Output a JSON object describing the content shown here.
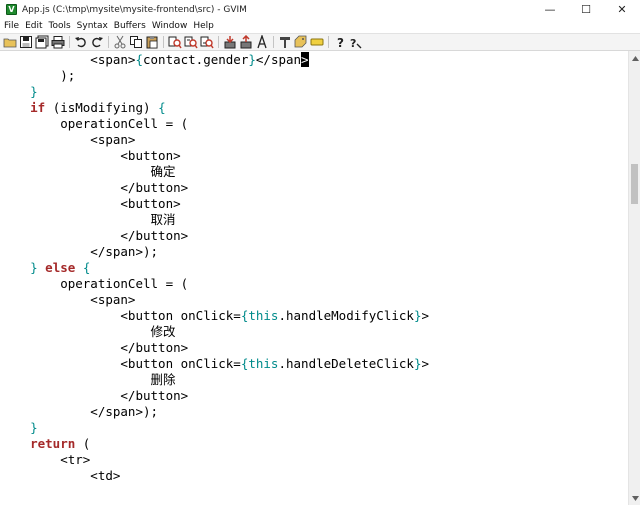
{
  "window": {
    "title": "App.js (C:\\tmp\\mysite\\mysite-frontend\\src) - GVIM",
    "app_icon_letter": "V",
    "controls": {
      "minimize": "—",
      "maximize": "☐",
      "close": "✕"
    }
  },
  "menu": [
    "File",
    "Edit",
    "Tools",
    "Syntax",
    "Buffers",
    "Window",
    "Help"
  ],
  "toolbar": [
    "open-icon",
    "save-icon",
    "save-all-icon",
    "print-icon",
    "sep",
    "undo-icon",
    "redo-icon",
    "sep",
    "cut-icon",
    "copy-icon",
    "paste-icon",
    "sep",
    "find-replace-icon",
    "find-next-icon",
    "find-prev-icon",
    "sep",
    "load-session-icon",
    "save-session-icon",
    "run-script-icon",
    "sep",
    "make-icon",
    "run-ctags-icon",
    "tag-jump-icon",
    "sep",
    "help-icon",
    "find-help-icon"
  ],
  "colors": {
    "keyword": "#a52a2a",
    "brace": "#008b8b",
    "this_keyword": "#008b8b",
    "text": "#000000"
  },
  "code": {
    "lines": [
      [
        {
          "t": "            <span>"
        },
        {
          "t": "{",
          "c": "br"
        },
        {
          "t": "contact.gender"
        },
        {
          "t": "}",
          "c": "br"
        },
        {
          "t": "</span"
        },
        {
          "t": ">",
          "c": "cursor"
        }
      ],
      [
        {
          "t": "        );"
        }
      ],
      [
        {
          "t": "    "
        },
        {
          "t": "}",
          "c": "br"
        }
      ],
      [
        {
          "t": "    "
        },
        {
          "t": "if",
          "c": "kw"
        },
        {
          "t": " (isModifying) "
        },
        {
          "t": "{",
          "c": "br"
        }
      ],
      [
        {
          "t": "        operationCell = ("
        }
      ],
      [
        {
          "t": "            <span>"
        }
      ],
      [
        {
          "t": "                <button>"
        }
      ],
      [
        {
          "t": "                    确定"
        }
      ],
      [
        {
          "t": "                </button>"
        }
      ],
      [
        {
          "t": "                <button>"
        }
      ],
      [
        {
          "t": "                    取消"
        }
      ],
      [
        {
          "t": "                </button>"
        }
      ],
      [
        {
          "t": "            </span>);"
        }
      ],
      [
        {
          "t": "    "
        },
        {
          "t": "}",
          "c": "br"
        },
        {
          "t": " "
        },
        {
          "t": "else",
          "c": "kw"
        },
        {
          "t": " "
        },
        {
          "t": "{",
          "c": "br"
        }
      ],
      [
        {
          "t": "        operationCell = ("
        }
      ],
      [
        {
          "t": "            <span>"
        }
      ],
      [
        {
          "t": "                <button onClick="
        },
        {
          "t": "{",
          "c": "br"
        },
        {
          "t": "this",
          "c": "th"
        },
        {
          "t": ".handleModifyClick"
        },
        {
          "t": "}",
          "c": "br"
        },
        {
          "t": ">"
        }
      ],
      [
        {
          "t": "                    修改"
        }
      ],
      [
        {
          "t": "                </button>"
        }
      ],
      [
        {
          "t": "                <button onClick="
        },
        {
          "t": "{",
          "c": "br"
        },
        {
          "t": "this",
          "c": "th"
        },
        {
          "t": ".handleDeleteClick"
        },
        {
          "t": "}",
          "c": "br"
        },
        {
          "t": ">"
        }
      ],
      [
        {
          "t": "                    删除"
        }
      ],
      [
        {
          "t": "                </button>"
        }
      ],
      [
        {
          "t": "            </span>);"
        }
      ],
      [
        {
          "t": "    "
        },
        {
          "t": "}",
          "c": "br"
        }
      ],
      [
        {
          "t": "    "
        },
        {
          "t": "return",
          "c": "kw"
        },
        {
          "t": " ("
        }
      ],
      [
        {
          "t": "        <tr>"
        }
      ],
      [
        {
          "t": "            <td>"
        }
      ]
    ]
  }
}
